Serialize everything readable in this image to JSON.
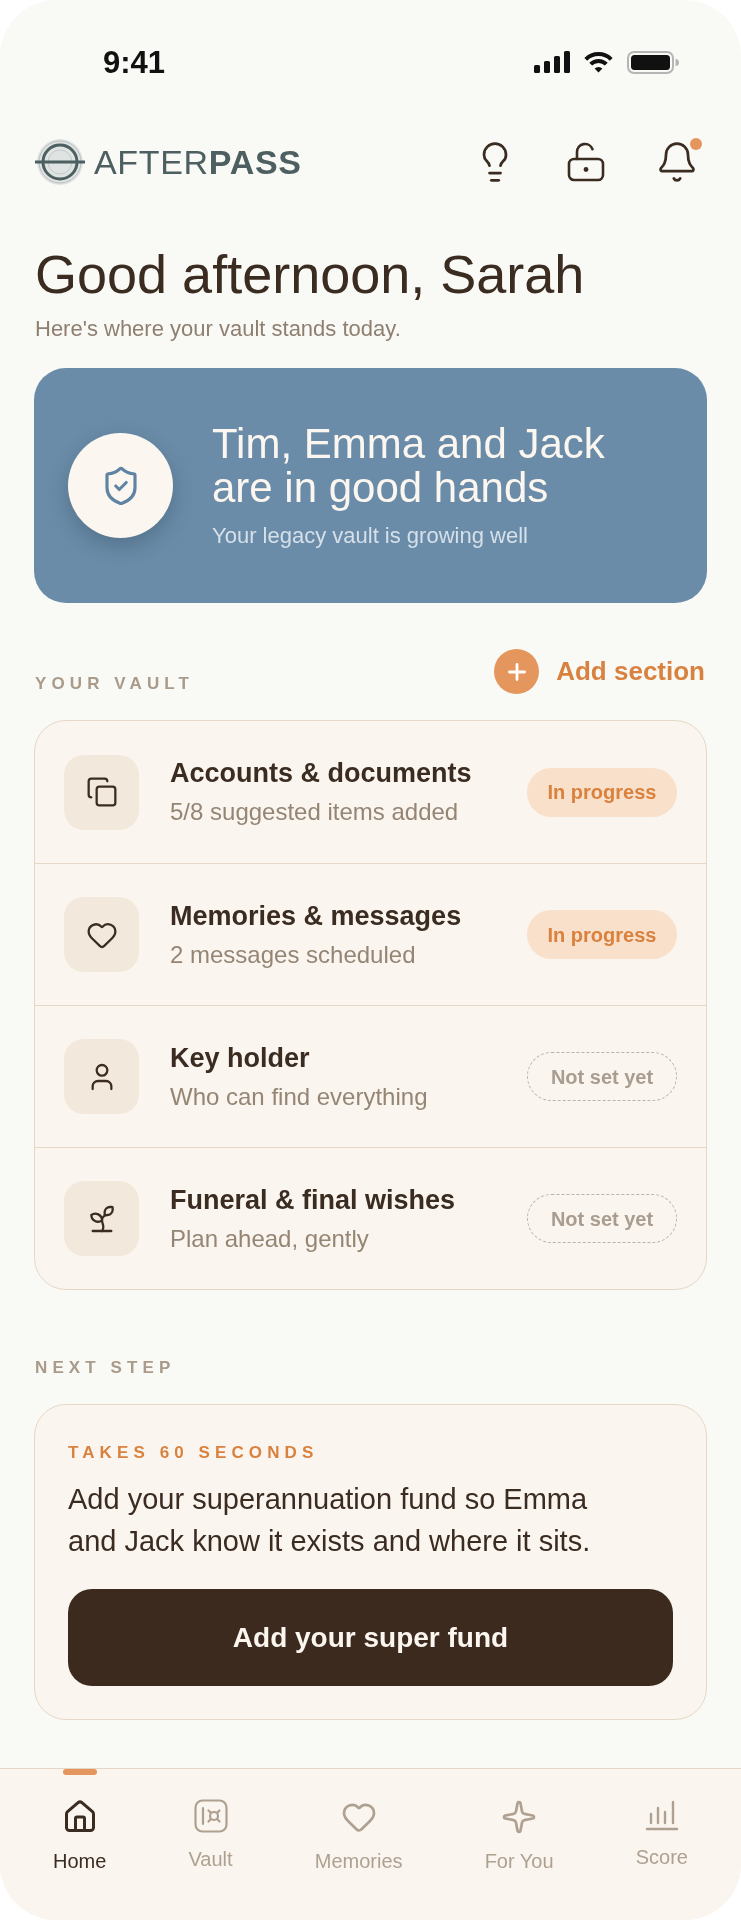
{
  "status_bar": {
    "time": "9:41"
  },
  "header": {
    "logo": "AFTER**PASS**",
    "notification_unread": true
  },
  "greeting": {
    "title": "Good afternoon, Sarah",
    "subtitle": "Here's where your vault stands today."
  },
  "hero": {
    "title": "Tim, Emma and Jack are in good hands",
    "subtitle": "Your legacy vault is growing well"
  },
  "vault": {
    "heading": "YOUR VAULT",
    "add_button": "Add section",
    "rows": [
      {
        "title": "Accounts & documents",
        "subtitle": "5/8 suggested items added",
        "status": {
          "label": "In progress",
          "kind": "in_progress"
        }
      },
      {
        "title": "Memories & messages",
        "subtitle": "2 messages scheduled",
        "status": {
          "label": "In progress",
          "kind": "in_progress"
        }
      },
      {
        "title": "Key holder",
        "subtitle": "Who can find everything",
        "status": {
          "label": "Not set yet",
          "kind": "not_set"
        }
      },
      {
        "title": "Funeral & final wishes",
        "subtitle": "Plan ahead, gently",
        "status": {
          "label": "Not set yet",
          "kind": "not_set"
        }
      }
    ]
  },
  "next_step": {
    "heading": "NEXT STEP",
    "eyebrow": "TAKES 60 SECONDS",
    "text": "Add your superannuation fund so Emma and Jack know it exists and where it sits.",
    "button": "Add your super fund"
  },
  "nav": [
    {
      "label": "Home",
      "selected": true
    },
    {
      "label": "Vault",
      "selected": false
    },
    {
      "label": "Memories",
      "selected": false
    },
    {
      "label": "For You",
      "selected": false
    },
    {
      "label": "Score",
      "selected": false
    }
  ]
}
